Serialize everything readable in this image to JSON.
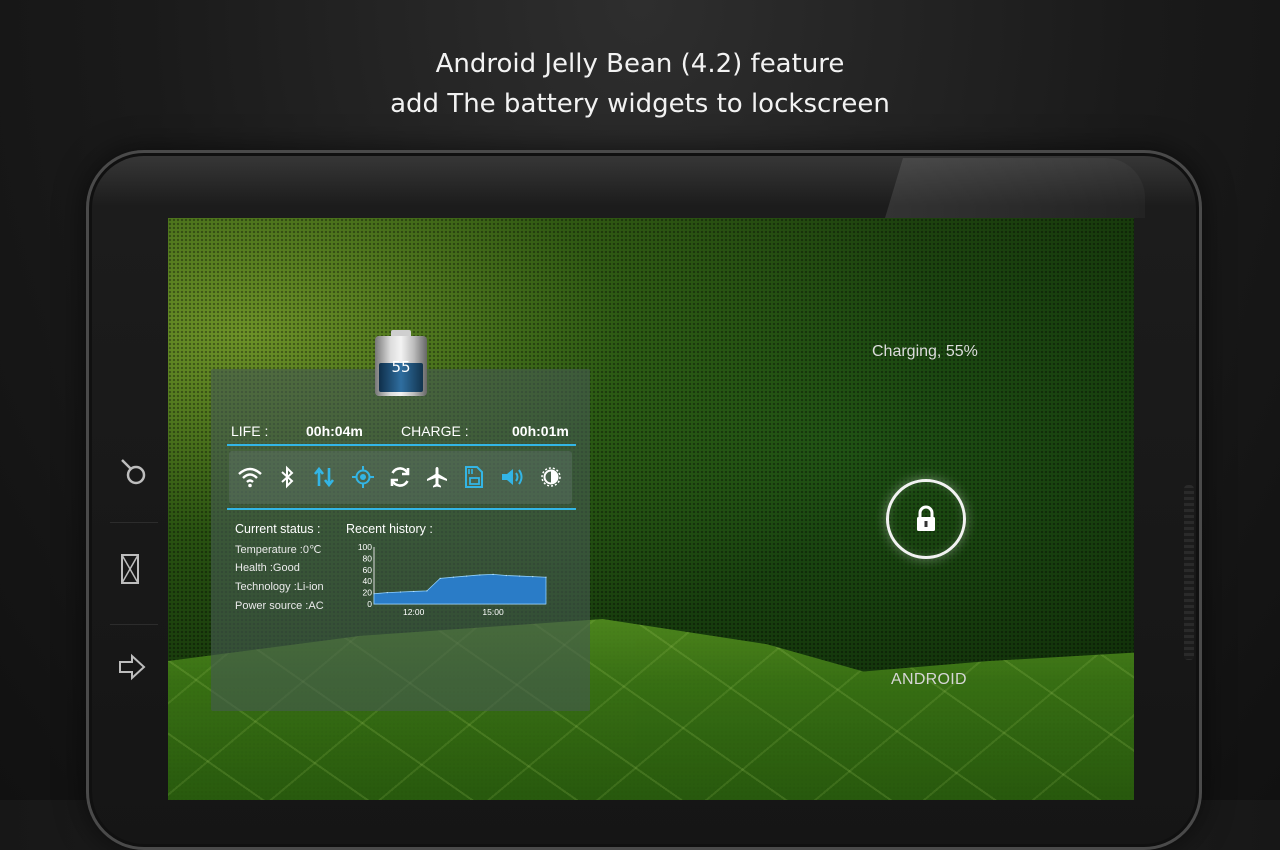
{
  "headline": {
    "line1": "Android Jelly Bean (4.2) feature",
    "line2": "add The battery widgets to lockscreen"
  },
  "device": {
    "side_buttons": [
      {
        "icon": "phone-rotate-icon"
      },
      {
        "icon": "screen-rotate-icon"
      },
      {
        "icon": "arrow-right-icon"
      }
    ]
  },
  "widget": {
    "battery_level": "55",
    "battery_fill_percent": 55,
    "life_label": "LIFE :",
    "life_value": "00h:04m",
    "charge_label": "CHARGE :",
    "charge_value": "00h:01m",
    "toggles": [
      {
        "icon": "wifi-icon"
      },
      {
        "icon": "bluetooth-icon"
      },
      {
        "icon": "data-sync-arrows-icon"
      },
      {
        "icon": "gps-icon"
      },
      {
        "icon": "auto-sync-icon"
      },
      {
        "icon": "airplane-icon"
      },
      {
        "icon": "sd-card-icon"
      },
      {
        "icon": "volume-icon"
      },
      {
        "icon": "brightness-icon"
      }
    ],
    "status_title": "Current status :",
    "status_lines": [
      "Temperature :0℃",
      "Health :Good",
      "Technology :Li-ion",
      "Power source :AC"
    ],
    "history_title": "Recent history :",
    "accent_color": "#33b5e5"
  },
  "chart_data": {
    "type": "area",
    "y_ticks": [
      "100",
      "80",
      "60",
      "40",
      "20",
      "0"
    ],
    "x_ticks": [
      "12:00",
      "15:00"
    ],
    "ylim": [
      0,
      100
    ],
    "x": [
      "10:30",
      "11:00",
      "11:30",
      "12:00",
      "12:30",
      "13:00",
      "13:30",
      "14:00",
      "14:30",
      "15:00",
      "15:30",
      "16:00",
      "16:30",
      "17:00"
    ],
    "values": [
      18,
      20,
      21,
      22,
      23,
      45,
      47,
      49,
      51,
      52,
      50,
      49,
      48,
      47
    ],
    "color": "#2a7cc7"
  },
  "lockscreen": {
    "charging_text": "Charging, 55%",
    "owner_text": "ANDROID",
    "lock_icon": "lock-icon"
  }
}
